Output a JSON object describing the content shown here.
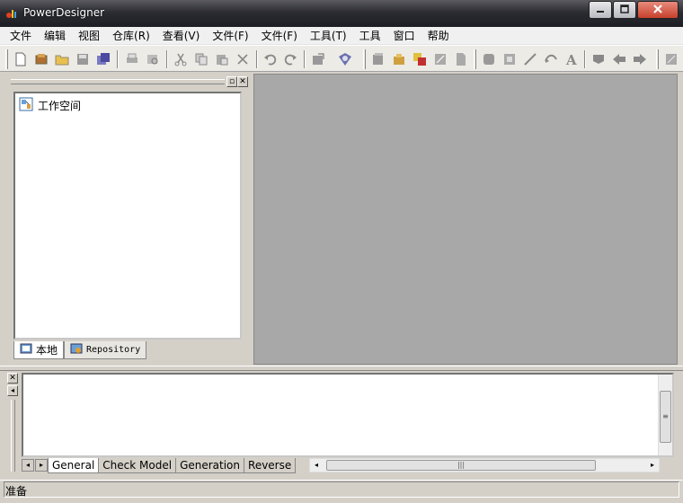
{
  "window": {
    "title": "PowerDesigner"
  },
  "menu": [
    {
      "label": "文件"
    },
    {
      "label": "编辑"
    },
    {
      "label": "视图"
    },
    {
      "label": "仓库(R)"
    },
    {
      "label": "查看(V)"
    },
    {
      "label": "文件(F)"
    },
    {
      "label": "文件(F)"
    },
    {
      "label": "工具(T)"
    },
    {
      "label": "工具"
    },
    {
      "label": "窗口"
    },
    {
      "label": "帮助"
    }
  ],
  "toolbar": {
    "icons": [
      "new-icon",
      "open-workspace-icon",
      "open-icon",
      "save-icon",
      "save-all-icon",
      "print-icon",
      "print-preview-icon",
      "cut-icon",
      "copy-icon",
      "paste-icon",
      "delete-icon",
      "undo-icon",
      "redo-icon",
      "check-model-icon",
      "repository-icon",
      "new-model-icon",
      "new-package-icon",
      "new-diagram-icon",
      "property-icon",
      "document-icon",
      "model-icon",
      "frame-icon",
      "line-icon",
      "link-icon",
      "text-icon",
      "flag-icon",
      "arrow-left-icon",
      "arrow-right-icon",
      "tail-icon"
    ]
  },
  "browser": {
    "tree_root": "工作空间",
    "tabs": [
      {
        "label": "本地"
      },
      {
        "label": "Repository"
      }
    ]
  },
  "output": {
    "tabs": [
      {
        "label": "General"
      },
      {
        "label": "Check Model"
      },
      {
        "label": "Generation"
      },
      {
        "label": "Reverse"
      }
    ]
  },
  "status": {
    "text": "准备"
  },
  "colors": {
    "workspace": "#a8a8a8",
    "chrome": "#d4d0c8",
    "titlebar": "#2c2d33"
  }
}
